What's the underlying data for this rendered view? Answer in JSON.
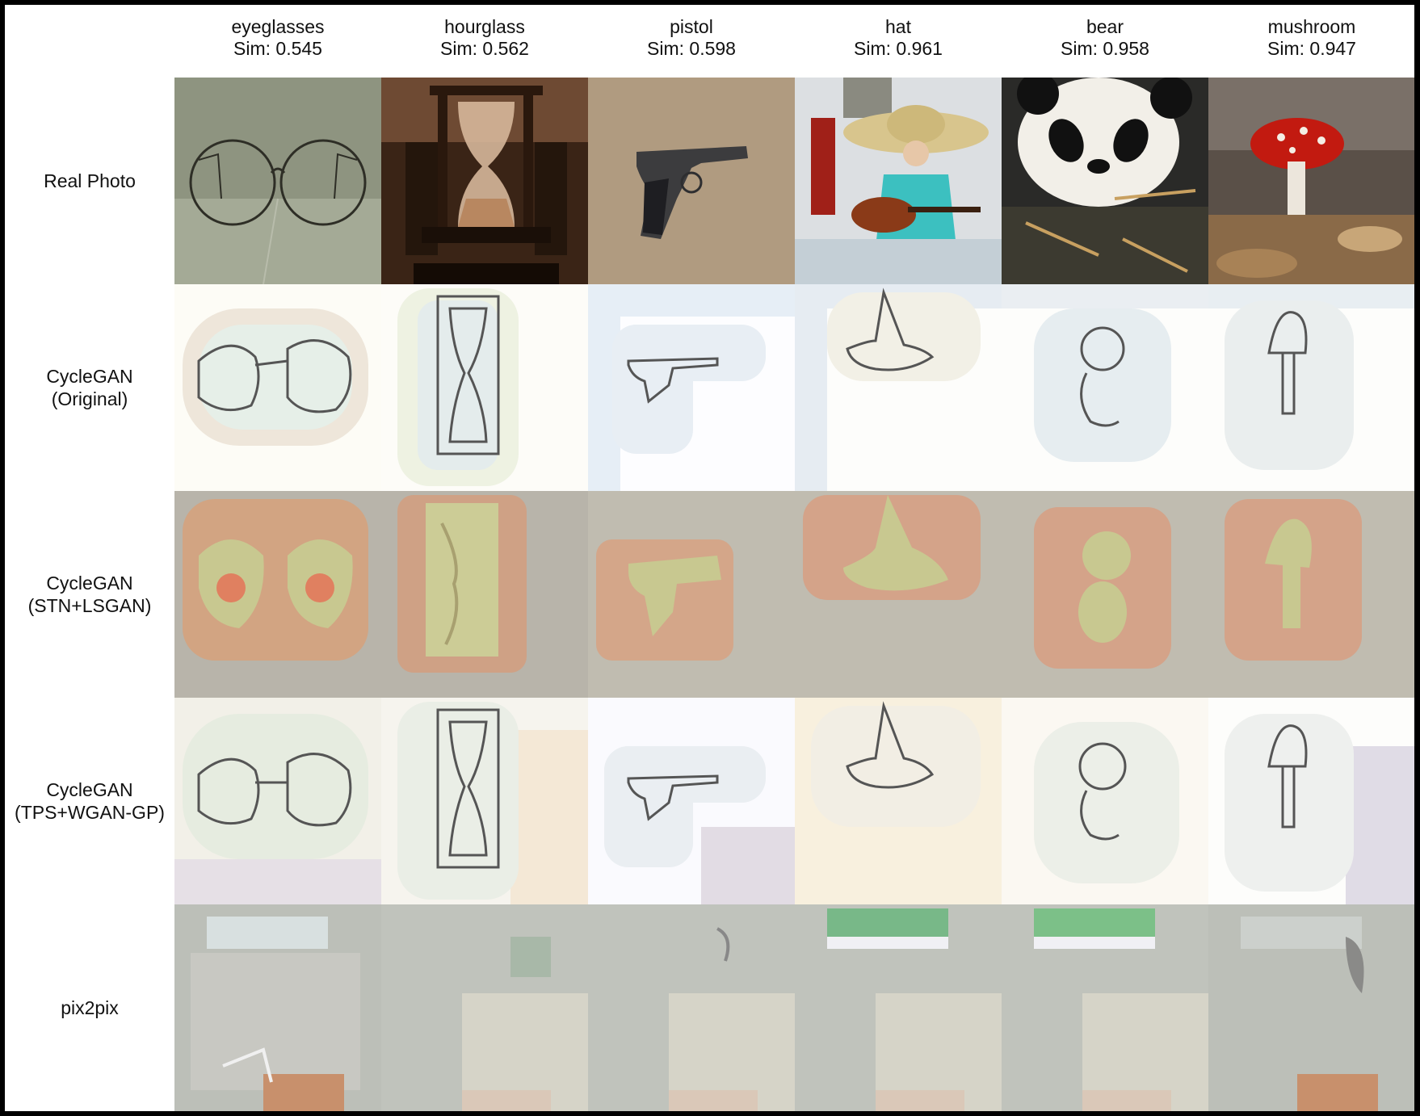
{
  "columns": [
    {
      "label": "eyeglasses",
      "sim": "Sim: 0.545"
    },
    {
      "label": "hourglass",
      "sim": "Sim: 0.562"
    },
    {
      "label": "pistol",
      "sim": "Sim: 0.598"
    },
    {
      "label": "hat",
      "sim": "Sim: 0.961"
    },
    {
      "label": "bear",
      "sim": "Sim: 0.958"
    },
    {
      "label": "mushroom",
      "sim": "Sim: 0.947"
    }
  ],
  "rows": [
    {
      "lines": [
        "Real Photo"
      ]
    },
    {
      "lines": [
        "CycleGAN",
        "(Original)"
      ]
    },
    {
      "lines": [
        "CycleGAN",
        "(STN+LSGAN)"
      ]
    },
    {
      "lines": [
        "CycleGAN",
        "(TPS+WGAN-GP)"
      ]
    },
    {
      "lines": [
        "pix2pix"
      ]
    }
  ],
  "colors": {
    "border": "#000000",
    "background": "#ffffff",
    "sketch_stroke": "#555555"
  }
}
